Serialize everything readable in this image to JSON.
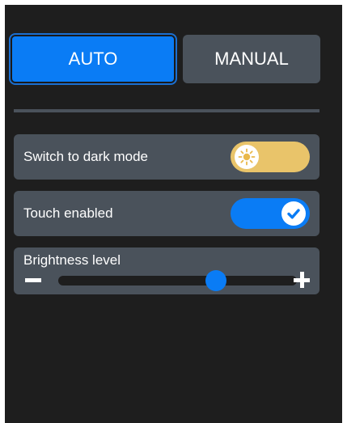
{
  "mode_tabs": {
    "auto_label": "AUTO",
    "manual_label": "MANUAL",
    "selected": "AUTO"
  },
  "settings": {
    "dark_mode": {
      "label": "Switch to dark mode",
      "state": "off",
      "icon": "sun-icon",
      "color": "#e9c46a"
    },
    "touch": {
      "label": "Touch enabled",
      "state": "on",
      "icon": "check-icon",
      "color": "#0a7cf5"
    },
    "brightness": {
      "label": "Brightness level",
      "level": 0.66,
      "decrease_icon": "minus-icon",
      "increase_icon": "plus-icon"
    }
  },
  "colors": {
    "accent": "#0a7cf5",
    "panel": "#4a525b",
    "background": "#1e1e1e",
    "dark_mode_switch": "#e9c46a"
  }
}
